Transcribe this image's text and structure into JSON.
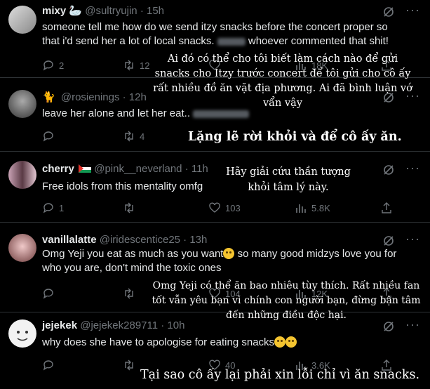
{
  "tweets": [
    {
      "name": "mixy",
      "name_emoji": "🦢",
      "handle": "@sultryujin · 15h",
      "text_1": "someone tell me how do we send itzy snacks before the concert proper so",
      "text_2": "that i'd send her a lot of local snacks.",
      "text_3": "whoever commented that shit!",
      "replies": "2",
      "reposts": "12",
      "likes": "",
      "views": "18K"
    },
    {
      "name": "",
      "handle": "@rosienings · 12h",
      "text_1": "leave her alone and let her eat..",
      "replies": "",
      "reposts": "4",
      "likes": "",
      "views": ""
    },
    {
      "name": "cherry",
      "handle": "@pink__neverland · 11h",
      "text_1": "Free idols from this mentality omfg",
      "replies": "1",
      "reposts": "",
      "likes": "103",
      "views": "5.8K"
    },
    {
      "name": "vanillalatte",
      "handle": "@iridescentice25 · 13h",
      "text_1": "Omg Yeji you eat as much as you want",
      "text_2": " so many good midzys love you for",
      "text_3": "who you are,  don't mind the toxic ones",
      "replies": "",
      "reposts": "",
      "likes": "104",
      "views": "12K"
    },
    {
      "name": "jejekek",
      "handle": "@jejekek289711 · 10h",
      "text_1": "why does she have to apologise for eating snacks",
      "replies": "",
      "reposts": "",
      "likes": "40",
      "views": "3.6K"
    }
  ],
  "overlays": {
    "t1": "Ai đó có thể cho tôi biết làm cách nào để gửi snacks cho Itzy trước concert để tôi gửi cho cô ấy rất nhiều đồ ăn vặt địa phương. Ai đã bình luận vớ vẩn vậy",
    "t2": "Lặng lẽ rời khỏi và để cô ấy ăn.",
    "t3": "Hãy giải cứu thần tượng khỏi tâm lý này.",
    "t4": "Omg Yeji có thể ăn bao nhiêu tùy thích. Rất nhiều fan tốt vẫn yêu bạn vì chính con người bạn, đừng bận tâm đến những điều độc hại.",
    "t5": "Tại sao cô ấy lại phải xin lỗi chỉ vì ăn snacks."
  },
  "colors": {
    "background": "#000000",
    "text": "#e7e9ea",
    "muted": "#71767b",
    "border": "#2f3336"
  }
}
